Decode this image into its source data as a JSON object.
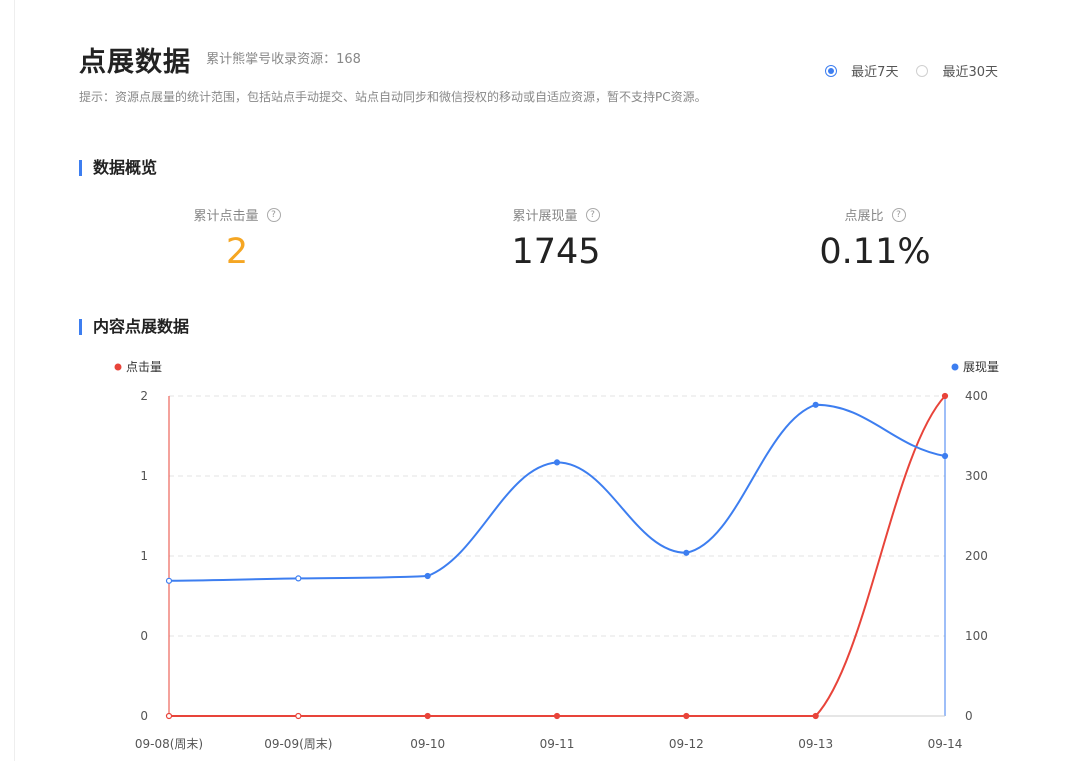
{
  "header": {
    "title": "点展数据",
    "sub_count": "累计熊掌号收录资源：168",
    "hint": "提示：资源点展量的统计范围，包括站点手动提交、站点自动同步和微信授权的移动或自适应资源，暂不支持PC资源。"
  },
  "range": {
    "options": [
      "最近7天",
      "最近30天"
    ],
    "selected": 0
  },
  "overview": {
    "title": "数据概览",
    "stats": [
      {
        "label": "累计点击量",
        "value": "2",
        "color": "#f5a623"
      },
      {
        "label": "累计展现量",
        "value": "1745"
      },
      {
        "label": "点展比",
        "value": "0.11%"
      }
    ],
    "help_glyph": "?"
  },
  "content": {
    "title": "内容点展数据"
  },
  "chart_data": {
    "type": "line",
    "categories": [
      "09-08(周末)",
      "09-09(周末)",
      "09-10",
      "09-11",
      "09-12",
      "09-13",
      "09-14"
    ],
    "series": [
      {
        "name": "点击量",
        "axis": "left",
        "color": "#e8443a",
        "values": [
          0,
          0,
          0,
          0,
          0,
          0,
          2
        ]
      },
      {
        "name": "展现量",
        "axis": "right",
        "color": "#3d7ef0",
        "values": [
          169,
          172,
          175,
          317,
          204,
          389,
          325
        ]
      }
    ],
    "y_left": {
      "ticks": [
        "0",
        "0",
        "1",
        "1",
        "2"
      ],
      "range": [
        0,
        2
      ]
    },
    "y_right": {
      "ticks": [
        "0",
        "100",
        "200",
        "300",
        "400"
      ],
      "range": [
        0,
        400
      ]
    },
    "grid": true,
    "legend": [
      "top-left",
      "top-right"
    ]
  }
}
